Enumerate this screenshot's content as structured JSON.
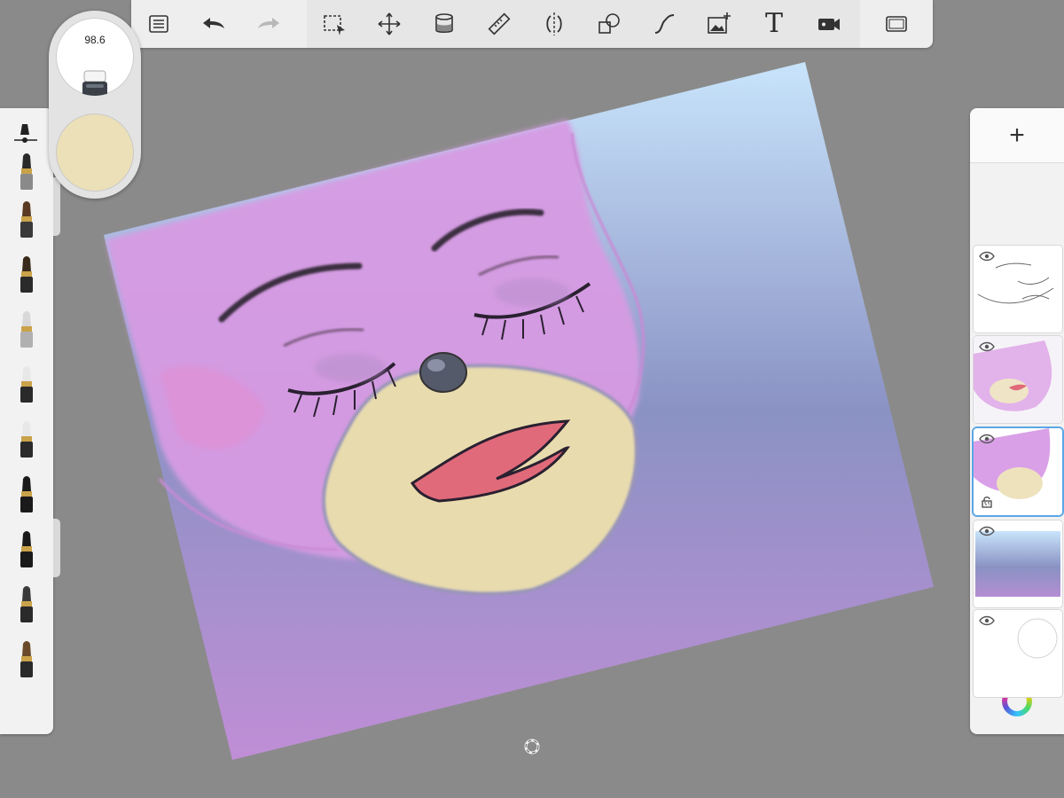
{
  "toolbar": {
    "left_group": [
      {
        "icon": "list-icon",
        "name": "menu-button"
      },
      {
        "icon": "undo-icon",
        "name": "undo-button"
      },
      {
        "icon": "redo-icon",
        "name": "redo-button"
      }
    ],
    "tools": [
      {
        "icon": "selection-icon",
        "name": "selection-tool-button"
      },
      {
        "icon": "transform-icon",
        "name": "transform-tool-button"
      },
      {
        "icon": "fill-bucket-icon",
        "name": "fill-tool-button"
      },
      {
        "icon": "ruler-icon",
        "name": "ruler-tool-button"
      },
      {
        "icon": "symmetry-icon",
        "name": "symmetry-tool-button"
      },
      {
        "icon": "shapes-icon",
        "name": "shape-tool-button"
      },
      {
        "icon": "curve-icon",
        "name": "curve-tool-button"
      },
      {
        "icon": "add-image-icon",
        "name": "add-image-button"
      },
      {
        "icon": "text-icon",
        "name": "text-tool-button",
        "glyph": "T"
      },
      {
        "icon": "video-camera-icon",
        "name": "time-lapse-button"
      }
    ],
    "right_group": [
      {
        "icon": "fullscreen-icon",
        "name": "fullscreen-button"
      }
    ]
  },
  "brush_puck": {
    "size_value": "98.6",
    "tool": "eraser-icon",
    "current_color": "#ece0b8"
  },
  "brushes": [
    {
      "name": "brush-pencil",
      "tip": "#2a2a2a",
      "body": "#8a8a8a"
    },
    {
      "name": "brush-paint",
      "tip": "#5a3a22",
      "body": "#3a3a3a"
    },
    {
      "name": "brush-ink",
      "tip": "#3a2a1a",
      "body": "#2a2a2a"
    },
    {
      "name": "brush-airbrush",
      "tip": "#d8d8d8",
      "body": "#b0b0b0"
    },
    {
      "name": "brush-marker-a",
      "tip": "#e8e8e8",
      "body": "#2a2a2a"
    },
    {
      "name": "brush-marker-b",
      "tip": "#e8e8e8",
      "body": "#2a2a2a"
    },
    {
      "name": "brush-chisel-a",
      "tip": "#1a1a1a",
      "body": "#1a1a1a"
    },
    {
      "name": "brush-chisel-b",
      "tip": "#1a1a1a",
      "body": "#1a1a1a"
    },
    {
      "name": "brush-flat-a",
      "tip": "#3a3a3a",
      "body": "#2a2a2a"
    },
    {
      "name": "brush-flat-b",
      "tip": "#6a4a2a",
      "body": "#2a2a2a"
    },
    {
      "name": "brush-flat-c",
      "tip": "#3a2a1a",
      "body": "#2a2a2a"
    }
  ],
  "layers": {
    "add_label": "+",
    "items": [
      {
        "name": "layer-sketch",
        "visible": true,
        "locked": false,
        "selected": false,
        "kind": "sketch"
      },
      {
        "name": "layer-color",
        "visible": true,
        "locked": false,
        "selected": false,
        "kind": "color"
      },
      {
        "name": "layer-paint",
        "visible": true,
        "locked": true,
        "selected": true,
        "kind": "paint"
      },
      {
        "name": "layer-gradient",
        "visible": true,
        "locked": false,
        "selected": false,
        "kind": "gradient"
      },
      {
        "name": "layer-background",
        "visible": true,
        "locked": false,
        "selected": false,
        "kind": "background"
      }
    ]
  },
  "colors": {
    "app_background": "#8a8a8a",
    "canvas_gradient_top": "#c8e4fb",
    "canvas_gradient_mid": "#8a92c4",
    "canvas_gradient_bottom": "#c08ed6",
    "face_pink": "#d59ae2",
    "muzzle": "#e8dcae",
    "lips": "#e06a7a",
    "nose": "#555a6a",
    "selection_blue": "#5aa7e6"
  }
}
